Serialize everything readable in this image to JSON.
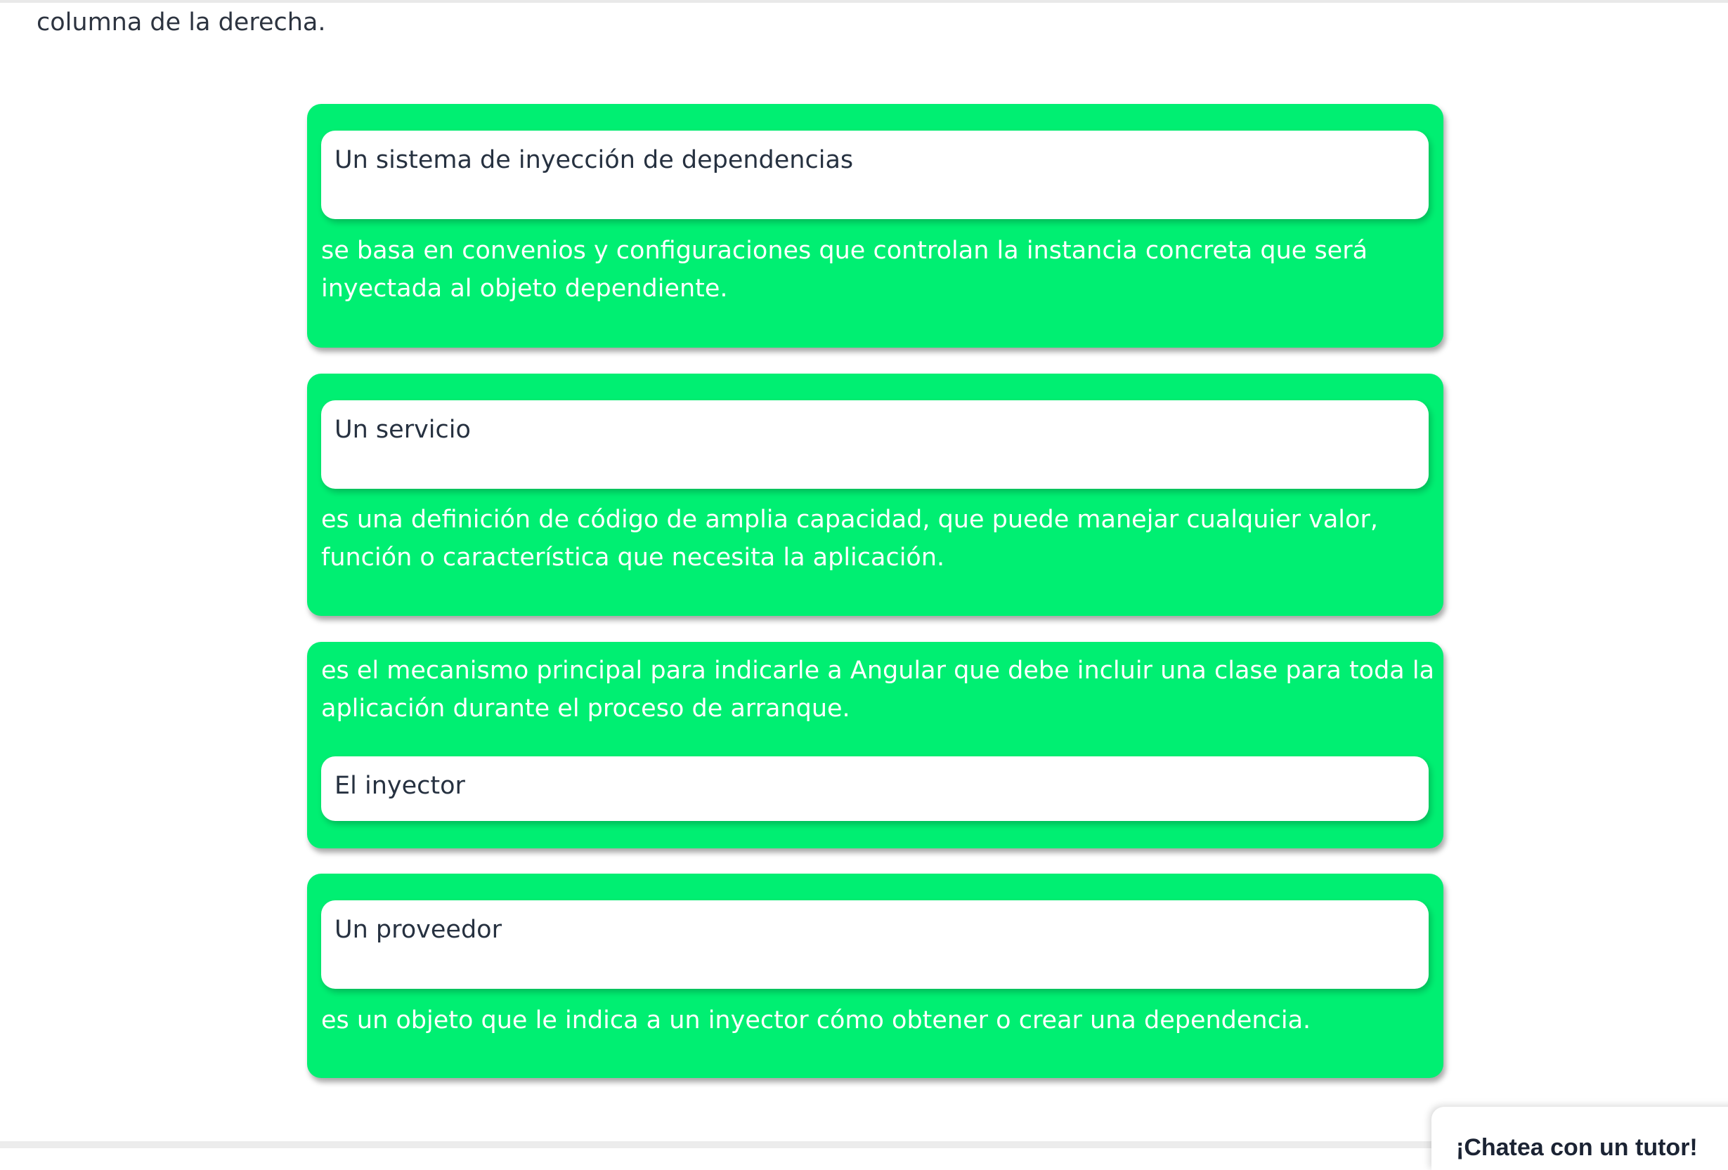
{
  "intro": {
    "text": "columna de la derecha."
  },
  "pairs": [
    {
      "term": "Un sistema de inyección de dependencias",
      "definition": "se basa en convenios y configuraciones que controlan la instancia concreta que será inyectada al objeto dependiente."
    },
    {
      "term": "Un servicio",
      "definition": "es una definición de código de amplia capacidad, que puede manejar cualquier valor, función o característica que necesita la aplicación."
    },
    {
      "term": "El inyector",
      "definition": "es el mecanismo principal para indicarle a Angular que debe incluir una clase para toda la aplicación durante el proceso de arranque."
    },
    {
      "term": "Un proveedor",
      "definition": "es un objeto que le indica a un inyector cómo obtener o crear una dependencia."
    }
  ],
  "chat": {
    "label": "¡Chatea con un tutor!"
  },
  "colors": {
    "card_green": "#00ef72",
    "term_background": "#ffffff",
    "definition_text": "#ffffff"
  }
}
